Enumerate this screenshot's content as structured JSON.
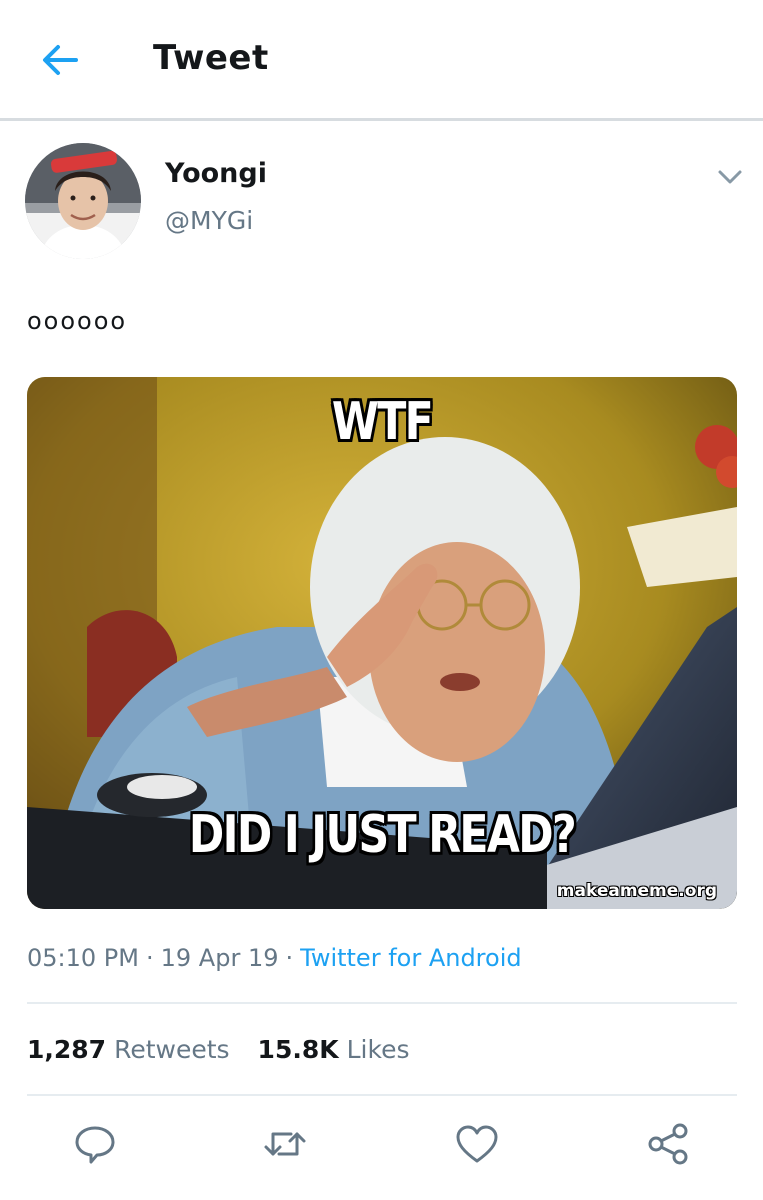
{
  "header": {
    "title": "Tweet",
    "back_icon": "arrow-left-icon"
  },
  "author": {
    "display_name": "Yoongi",
    "handle": "@MYGi"
  },
  "tweet": {
    "text": "oooooo",
    "meme": {
      "top_text": "WTF",
      "bottom_text": "DID I JUST READ?",
      "watermark": "makeameme.org"
    }
  },
  "meta": {
    "time": "05:10 PM",
    "date": "19 Apr 19",
    "source": "Twitter for Android"
  },
  "stats": {
    "retweets_count": "1,287",
    "retweets_label": "Retweets",
    "likes_count": "15.8K",
    "likes_label": "Likes"
  },
  "actions": [
    "reply-icon",
    "retweet-icon",
    "like-icon",
    "share-icon"
  ],
  "colors": {
    "accent": "#1da1f2",
    "secondary_text": "#657786",
    "divider": "#e6ecf0"
  }
}
